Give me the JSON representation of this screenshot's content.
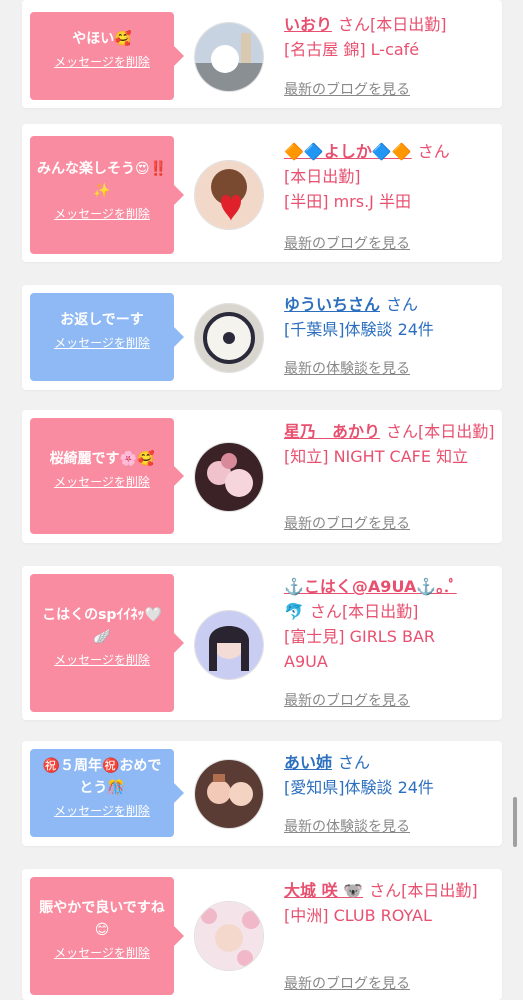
{
  "items": [
    {
      "message": "やほい🥰",
      "delete_label": "メッセージを削除",
      "name": "いおり",
      "san": "さん",
      "detail": "[本日出勤]",
      "line2": "[名古屋 錦] L-café",
      "line3": "",
      "link": "最新のブログを見る",
      "bubble_color": "#f98ca0",
      "text_color": "#e8506f",
      "avatar_desc": "castle-photo"
    },
    {
      "message": "みんな楽しそう😍‼️✨",
      "delete_label": "メッセージを削除",
      "name": "🔶🔷よしか🔷🔶",
      "san": "さん",
      "detail": "[本日出勤]",
      "line2": "[半田] mrs.J 半田",
      "line3": "",
      "link": "最新のブログを見る",
      "bubble_color": "#f98ca0",
      "text_color": "#e8506f",
      "avatar_desc": "girl-heart-balloon"
    },
    {
      "message": "お返しでーす",
      "delete_label": "メッセージを削除",
      "name": "ゆういちさん",
      "san": "さん",
      "detail": "",
      "line2": "[千葉県]体験談 24件",
      "line3": "",
      "link": "最新の体験談を見る",
      "bubble_color": "#8fb9f5",
      "text_color": "#2c6fbe",
      "avatar_desc": "cup-photo"
    },
    {
      "message": "桜綺麗です🌸🥰",
      "delete_label": "メッセージを削除",
      "name": "星乃　あかり",
      "san": "さん",
      "detail": "[本日出勤]",
      "line2": "[知立] NIGHT CAFE 知立",
      "line3": "",
      "link": "最新のブログを見る",
      "bubble_color": "#f98ca0",
      "text_color": "#e8506f",
      "avatar_desc": "flowers-photo"
    },
    {
      "message": "こはくのspｲｲﾈｯ🤍🪽",
      "delete_label": "メッセージを削除",
      "name": "⚓️こはく@A9UA⚓️｡.ﾟ",
      "name2": "🐬",
      "san": "さん",
      "detail": "[本日出勤]",
      "line2": "[富士見] GIRLS BAR",
      "line3": "A9UA",
      "link": "最新のブログを見る",
      "bubble_color": "#f98ca0",
      "text_color": "#e8506f",
      "avatar_desc": "girl-portrait"
    },
    {
      "message": "㊗️５周年㊗️おめでとう🎊",
      "delete_label": "メッセージを削除",
      "name": "あい姉",
      "san": "さん",
      "detail": "",
      "line2": "[愛知県]体験談 24件",
      "line3": "",
      "link": "最新の体験談を見る",
      "bubble_color": "#8fb9f5",
      "text_color": "#2c6fbe",
      "avatar_desc": "two-girls-photo"
    },
    {
      "message": "賑やかで良いですね😊",
      "delete_label": "メッセージを削除",
      "name": "大城 咲 🐨",
      "san": "さん",
      "detail": "[本日出勤]",
      "line2": "[中洲] CLUB ROYAL",
      "line3": "",
      "link": "最新のブログを見る",
      "bubble_color": "#f98ca0",
      "text_color": "#e8506f",
      "avatar_desc": "girl-blossoms"
    }
  ]
}
